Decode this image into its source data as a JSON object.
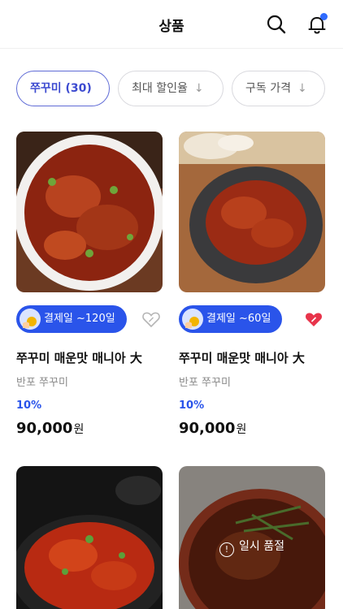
{
  "header": {
    "title": "상품",
    "search_icon": "search-icon",
    "bell_icon": "bell-icon",
    "notification_dot_color": "#2f6bff"
  },
  "filters": [
    {
      "label": "쭈꾸미 (30)",
      "active": true
    },
    {
      "label": "최대 할인율",
      "active": false,
      "icon": "arrow-down-icon"
    },
    {
      "label": "구독 가격",
      "active": false,
      "icon": "arrow-down-icon"
    }
  ],
  "arrow_glyph": "↓",
  "accent_color": "#2a54ea",
  "products": [
    {
      "badge": "결제일 ~120일",
      "name": "쭈꾸미 매운맛 매니아 大",
      "brand": "반포 쭈꾸미",
      "discount": "10%",
      "price": "90,000",
      "currency": "원",
      "liked": false
    },
    {
      "badge": "결제일 ~60일",
      "name": "쭈꾸미 매운맛 매니아 大",
      "brand": "반포 쭈꾸미",
      "discount": "10%",
      "price": "90,000",
      "currency": "원",
      "liked": true
    },
    {
      "sold_out": false
    },
    {
      "sold_out": true,
      "sold_out_label": "일시 품절"
    }
  ]
}
